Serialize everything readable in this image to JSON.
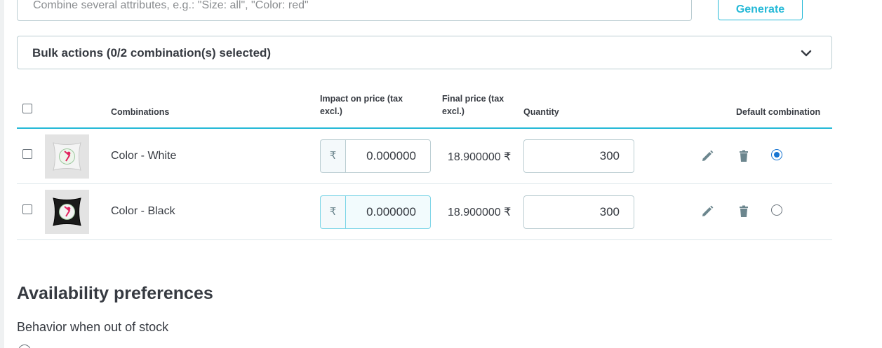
{
  "attributes": {
    "placeholder": "Combine several attributes, e.g.: \"Size: all\", \"Color: red\"",
    "generate_label": "Generate"
  },
  "bulk": {
    "label": "Bulk actions (0/2 combination(s) selected)"
  },
  "table": {
    "headers": {
      "combinations": "Combinations",
      "impact_line1": "Impact on price (tax",
      "impact_line2": "excl.)",
      "final_line1": "Final price (tax",
      "final_line2": "excl.)",
      "quantity": "Quantity",
      "default": "Default combination"
    },
    "currency_symbol": "₹",
    "rows": [
      {
        "name": "Color - White",
        "impact": "0.000000",
        "final_price": "18.900000 ₹",
        "quantity": "300",
        "is_default": true,
        "thumb_cushion_color": "#f4f4f4"
      },
      {
        "name": "Color - Black",
        "impact": "0.000000",
        "final_price": "18.900000 ₹",
        "quantity": "300",
        "is_default": false,
        "thumb_cushion_color": "#1a1a1a"
      }
    ]
  },
  "availability": {
    "title": "Availability preferences",
    "behavior_label": "Behavior when out of stock"
  },
  "colors": {
    "accent": "#25b9d7",
    "radio_checked": "#1976d2",
    "text": "#363a41",
    "border": "#bbcdd2"
  },
  "icons": {
    "edit": "pencil-icon",
    "delete": "trash-icon",
    "expand": "chevron-down-icon"
  }
}
